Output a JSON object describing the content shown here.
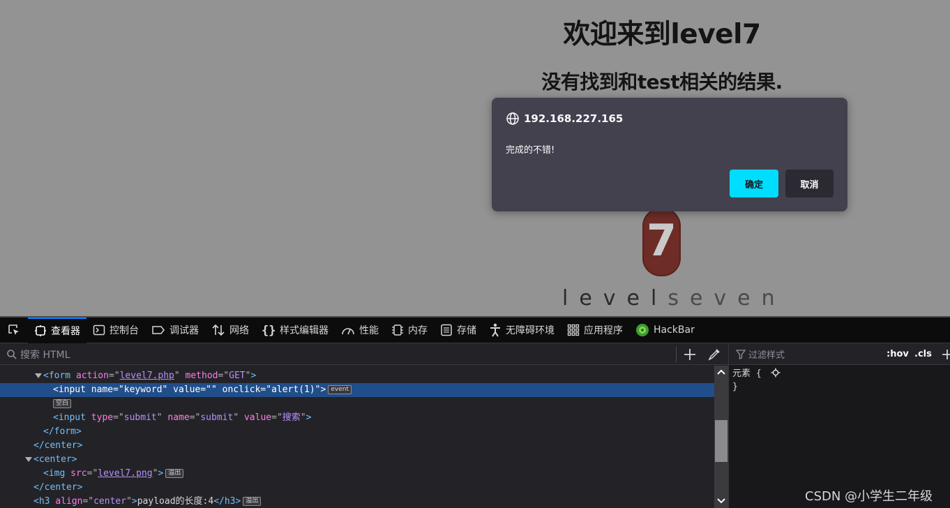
{
  "page": {
    "heading": "欢迎来到level7",
    "result": "没有找到和test相关的结果.",
    "logo_digit": "7",
    "brand_part1": "level",
    "brand_part2": "seven"
  },
  "dialog": {
    "host": "192.168.227.165",
    "message": "完成的不错!",
    "ok_label": "确定",
    "cancel_label": "取消"
  },
  "devtools": {
    "tabs": [
      {
        "label": "查看器",
        "icon": "inspector-icon"
      },
      {
        "label": "控制台",
        "icon": "console-icon"
      },
      {
        "label": "调试器",
        "icon": "debugger-icon"
      },
      {
        "label": "网络",
        "icon": "network-icon"
      },
      {
        "label": "样式编辑器",
        "icon": "style-editor-icon"
      },
      {
        "label": "性能",
        "icon": "performance-icon"
      },
      {
        "label": "内存",
        "icon": "memory-icon"
      },
      {
        "label": "存储",
        "icon": "storage-icon"
      },
      {
        "label": "无障碍环境",
        "icon": "accessibility-icon"
      },
      {
        "label": "应用程序",
        "icon": "application-icon"
      },
      {
        "label": "HackBar",
        "icon": "hackbar-icon"
      }
    ],
    "search_placeholder": "搜索 HTML",
    "filter_placeholder": "过滤样式",
    "hov_label": ":hov",
    "cls_label": ".cls",
    "rule_selector": "元素 {",
    "rule_close": "}",
    "badges": {
      "event": "event",
      "whitespace": "空白",
      "overflow": "溢出"
    },
    "markup": {
      "form_tag": "<form",
      "form_action_attr": "action",
      "form_action_val": "level7.php",
      "form_method_attr": "method",
      "form_method_val": "GET",
      "selected_line": "<input name=\"keyword\" value=\"\" onclick=\"alert(1)\">",
      "input2_tag": "<input",
      "input2_type_attr": "type",
      "input2_type_val": "submit",
      "input2_name_attr": "name",
      "input2_name_val": "submit",
      "input2_value_attr": "value",
      "input2_value_val": "搜索",
      "form_close": "</form>",
      "center_close": "</center>",
      "center_open": "<center>",
      "img_tag": "<img",
      "img_src_attr": "src",
      "img_src_val": "level7.png",
      "h3_tag": "<h3",
      "h3_align_attr": "align",
      "h3_align_val": "center",
      "h3_text": "payload的长度:4",
      "h3_close": "</h3>"
    }
  },
  "watermark": "CSDN @小学生二年级"
}
